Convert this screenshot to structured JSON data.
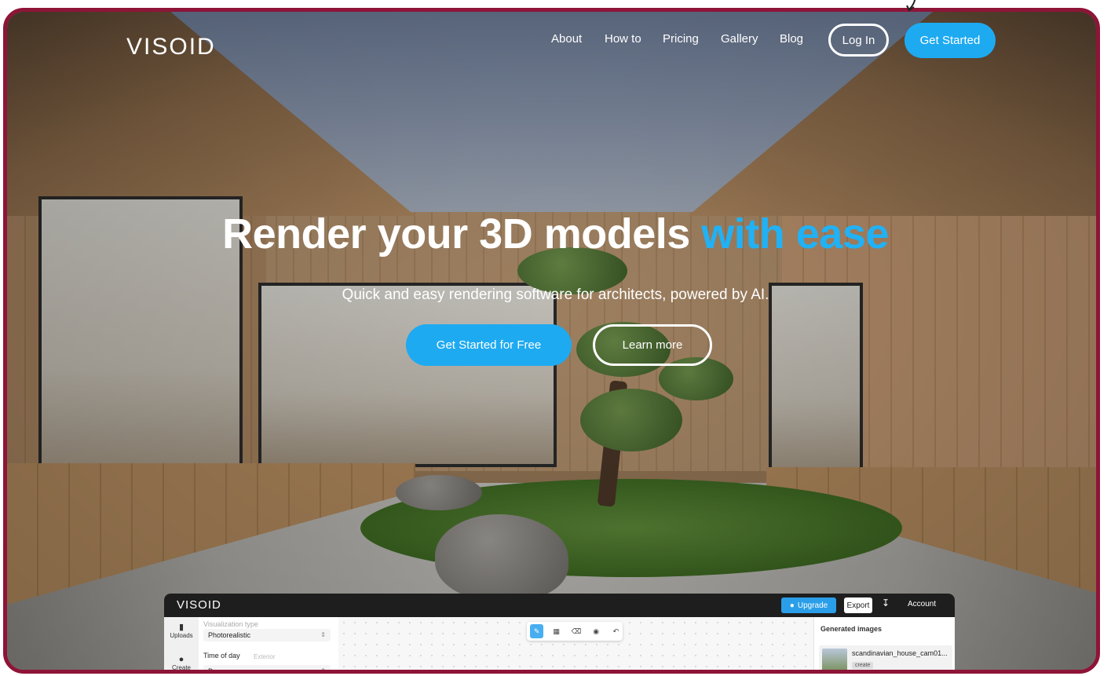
{
  "nav": {
    "logo": "VISOID",
    "links": [
      "About",
      "How to",
      "Pricing",
      "Gallery",
      "Blog"
    ],
    "login_label": "Log In",
    "get_started_label": "Get Started"
  },
  "hero": {
    "title_main": "Render your 3D models ",
    "title_accent": "with ease",
    "subtitle": "Quick and easy rendering software for architects, powered by AI.",
    "primary_cta": "Get Started for Free",
    "secondary_cta": "Learn more"
  },
  "app_preview": {
    "logo": "VISOID",
    "upgrade_label": "Upgrade",
    "export_label": "Export",
    "account_label": "Account",
    "sidebar": [
      {
        "label": "Uploads",
        "icon": "folder-icon"
      },
      {
        "label": "Create",
        "icon": "pin-icon"
      }
    ],
    "panel": {
      "visualization_type_label": "Visualization type",
      "visualization_type_value": "Photorealistic",
      "time_of_day_label": "Time of day",
      "exterior_label": "Exterior",
      "time_of_day_value": "Day"
    },
    "right_panel": {
      "title": "Generated images",
      "item_name": "scandinavian_house_cam01...",
      "item_tag": "create"
    }
  },
  "colors": {
    "accent": "#1eaaf1",
    "border": "#8e1438"
  }
}
